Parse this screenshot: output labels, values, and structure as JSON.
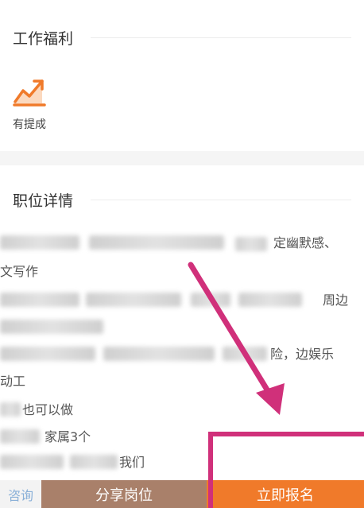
{
  "welfare": {
    "title": "工作福利",
    "benefits": [
      {
        "label": "有提成",
        "icon": "trend-chart-icon"
      }
    ]
  },
  "detail": {
    "title": "职位详情",
    "lines": [
      "定幽默感、",
      "文写作",
      "周边",
      "险，边娱乐",
      "动工",
      "也可以做",
      "家属3个",
      "我们"
    ]
  },
  "actions": {
    "consult_label": "咨询",
    "share_label": "分享岗位",
    "apply_label": "立即报名"
  },
  "colors": {
    "accent": "#f07a2a",
    "share": "#a9806a",
    "annotation": "#d0307a"
  }
}
